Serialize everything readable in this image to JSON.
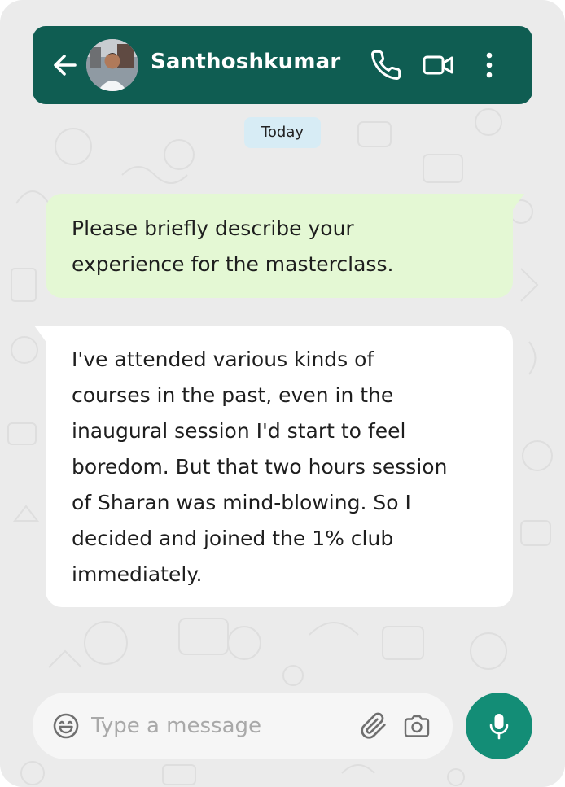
{
  "header": {
    "contact_name": "Santhoshkumar",
    "background_color": "#0f5d52",
    "icons": [
      "back-arrow-icon",
      "phone-icon",
      "video-camera-icon",
      "more-options-icon"
    ]
  },
  "chat": {
    "date_label": "Today",
    "messages": [
      {
        "direction": "outgoing",
        "bubble_color": "#e4f8d4",
        "lines": [
          "Please briefly describe your",
          "experience for the masterclass."
        ]
      },
      {
        "direction": "incoming",
        "bubble_color": "#ffffff",
        "lines": [
          "I've attended various kinds of",
          "courses in the past, even in the",
          "inaugural session I'd start to feel",
          "boredom. But that two hours session",
          "of Sharan was mind-blowing. So I",
          "decided and joined the 1% club",
          "immediately."
        ]
      }
    ]
  },
  "composer": {
    "placeholder": "Type a message",
    "icons": [
      "emoji-icon",
      "paperclip-icon",
      "camera-icon",
      "microphone-icon"
    ],
    "mic_button_color": "#138d76"
  }
}
